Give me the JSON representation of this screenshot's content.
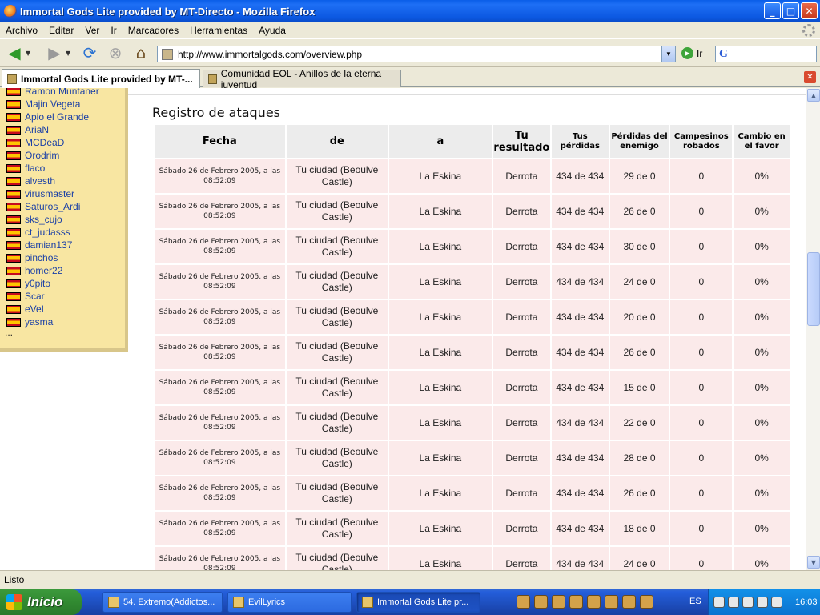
{
  "window": {
    "title": "Immortal Gods Lite provided by MT-Directo - Mozilla Firefox",
    "buttons": {
      "minimize": "_",
      "maximize": "□",
      "close": "✕"
    }
  },
  "menu": [
    "Archivo",
    "Editar",
    "Ver",
    "Ir",
    "Marcadores",
    "Herramientas",
    "Ayuda"
  ],
  "toolbar": {
    "url": "http://www.immortalgods.com/overview.php",
    "go_label": "Ir",
    "search_engine_glyph": "G"
  },
  "tabs": [
    {
      "label": "Immortal Gods Lite provided by MT-...",
      "active": true
    },
    {
      "label": "Comunidad EOL - Anillos de la eterna juventud",
      "active": false
    }
  ],
  "sidebar": {
    "players": [
      "Ramon Muntaner",
      "Majin Vegeta",
      "Apio el Grande",
      "AriaN",
      "MCDeaD",
      "Orodrim",
      "flaco",
      "alvesth",
      "virusmaster",
      "Saturos_Ardi",
      "sks_cujo",
      "ct_judasss",
      "damian137",
      "pinchos",
      "homer22",
      "y0pito",
      "Scar",
      "eVeL",
      "yasma"
    ],
    "more": "..."
  },
  "attacks": {
    "title": "Registro de ataques",
    "headers": [
      "Fecha",
      "de",
      "a",
      "Tu resultado",
      "Tus pérdidas",
      "Pérdidas del enemigo",
      "Campesinos robados",
      "Cambio en el favor"
    ],
    "rows": [
      {
        "fecha": "Sábado 26 de Febrero 2005, a las 08:52:09",
        "de": "Tu ciudad (Beoulve Castle)",
        "a": "La Eskina",
        "resultado": "Derrota",
        "tus_perdidas": "434 de 434",
        "perdidas_enemigo": "29 de 0",
        "campesinos": "0",
        "cambio": "0%"
      },
      {
        "fecha": "Sábado 26 de Febrero 2005, a las 08:52:09",
        "de": "Tu ciudad (Beoulve Castle)",
        "a": "La Eskina",
        "resultado": "Derrota",
        "tus_perdidas": "434 de 434",
        "perdidas_enemigo": "26 de 0",
        "campesinos": "0",
        "cambio": "0%"
      },
      {
        "fecha": "Sábado 26 de Febrero 2005, a las 08:52:09",
        "de": "Tu ciudad (Beoulve Castle)",
        "a": "La Eskina",
        "resultado": "Derrota",
        "tus_perdidas": "434 de 434",
        "perdidas_enemigo": "30 de 0",
        "campesinos": "0",
        "cambio": "0%"
      },
      {
        "fecha": "Sábado 26 de Febrero 2005, a las 08:52:09",
        "de": "Tu ciudad (Beoulve Castle)",
        "a": "La Eskina",
        "resultado": "Derrota",
        "tus_perdidas": "434 de 434",
        "perdidas_enemigo": "24 de 0",
        "campesinos": "0",
        "cambio": "0%"
      },
      {
        "fecha": "Sábado 26 de Febrero 2005, a las 08:52:09",
        "de": "Tu ciudad (Beoulve Castle)",
        "a": "La Eskina",
        "resultado": "Derrota",
        "tus_perdidas": "434 de 434",
        "perdidas_enemigo": "20 de 0",
        "campesinos": "0",
        "cambio": "0%"
      },
      {
        "fecha": "Sábado 26 de Febrero 2005, a las 08:52:09",
        "de": "Tu ciudad (Beoulve Castle)",
        "a": "La Eskina",
        "resultado": "Derrota",
        "tus_perdidas": "434 de 434",
        "perdidas_enemigo": "26 de 0",
        "campesinos": "0",
        "cambio": "0%"
      },
      {
        "fecha": "Sábado 26 de Febrero 2005, a las 08:52:09",
        "de": "Tu ciudad (Beoulve Castle)",
        "a": "La Eskina",
        "resultado": "Derrota",
        "tus_perdidas": "434 de 434",
        "perdidas_enemigo": "15 de 0",
        "campesinos": "0",
        "cambio": "0%"
      },
      {
        "fecha": "Sábado 26 de Febrero 2005, a las 08:52:09",
        "de": "Tu ciudad (Beoulve Castle)",
        "a": "La Eskina",
        "resultado": "Derrota",
        "tus_perdidas": "434 de 434",
        "perdidas_enemigo": "22 de 0",
        "campesinos": "0",
        "cambio": "0%"
      },
      {
        "fecha": "Sábado 26 de Febrero 2005, a las 08:52:09",
        "de": "Tu ciudad (Beoulve Castle)",
        "a": "La Eskina",
        "resultado": "Derrota",
        "tus_perdidas": "434 de 434",
        "perdidas_enemigo": "28 de 0",
        "campesinos": "0",
        "cambio": "0%"
      },
      {
        "fecha": "Sábado 26 de Febrero 2005, a las 08:52:09",
        "de": "Tu ciudad (Beoulve Castle)",
        "a": "La Eskina",
        "resultado": "Derrota",
        "tus_perdidas": "434 de 434",
        "perdidas_enemigo": "26 de 0",
        "campesinos": "0",
        "cambio": "0%"
      },
      {
        "fecha": "Sábado 26 de Febrero 2005, a las 08:52:09",
        "de": "Tu ciudad (Beoulve Castle)",
        "a": "La Eskina",
        "resultado": "Derrota",
        "tus_perdidas": "434 de 434",
        "perdidas_enemigo": "18 de 0",
        "campesinos": "0",
        "cambio": "0%"
      },
      {
        "fecha": "Sábado 26 de Febrero 2005, a las 08:52:09",
        "de": "Tu ciudad (Beoulve Castle)",
        "a": "La Eskina",
        "resultado": "Derrota",
        "tus_perdidas": "434 de 434",
        "perdidas_enemigo": "24 de 0",
        "campesinos": "0",
        "cambio": "0%"
      }
    ]
  },
  "status": {
    "text": "Listo"
  },
  "taskbar": {
    "start_label": "Inicio",
    "tasks": [
      {
        "label": "54. Extremo(Addictos...",
        "active": false
      },
      {
        "label": "EvilLyrics",
        "active": false
      },
      {
        "label": "Immortal Gods Lite pr...",
        "active": true
      }
    ],
    "language": "ES",
    "clock": "16:03"
  }
}
